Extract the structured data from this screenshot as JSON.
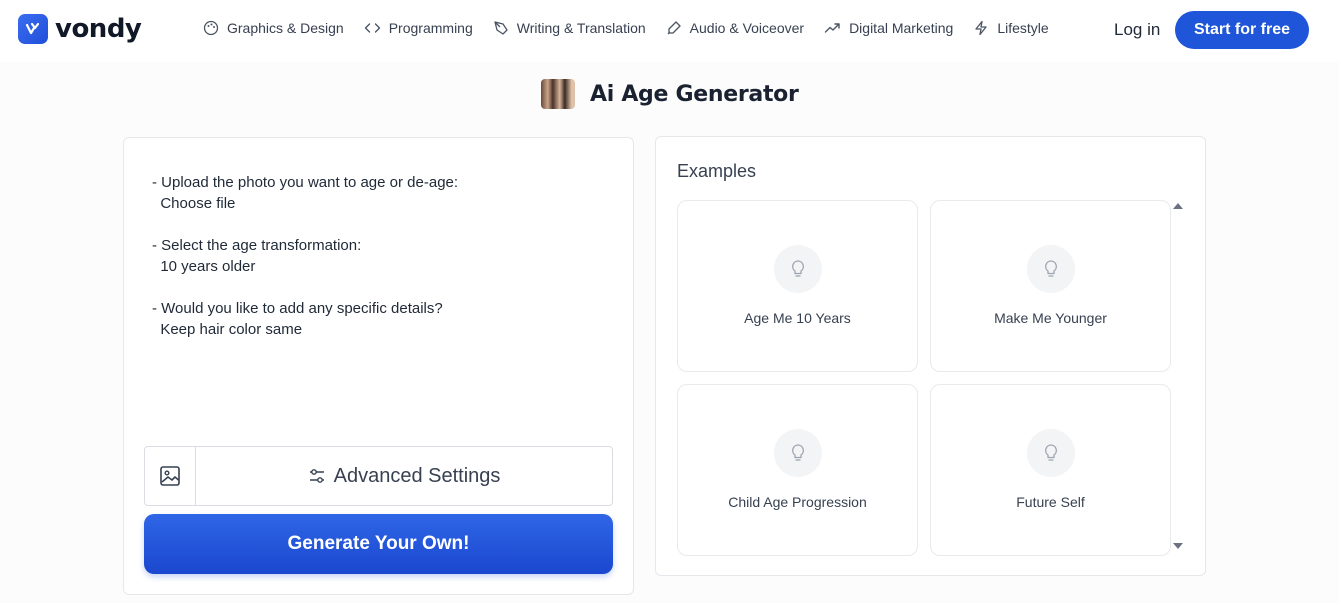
{
  "brand": {
    "name": "vondy",
    "accent": "#1f55d8"
  },
  "nav": {
    "items": [
      {
        "label": "Graphics & Design",
        "icon": "palette-icon"
      },
      {
        "label": "Programming",
        "icon": "code-icon"
      },
      {
        "label": "Writing & Translation",
        "icon": "pen-nib-icon"
      },
      {
        "label": "Audio & Voiceover",
        "icon": "microphone-icon"
      },
      {
        "label": "Digital Marketing",
        "icon": "trend-up-icon"
      },
      {
        "label": "Lifestyle",
        "icon": "lightning-icon"
      }
    ],
    "login": "Log in",
    "start": "Start for free"
  },
  "page": {
    "title": "Ai Age Generator"
  },
  "prompt": {
    "lines": [
      "- Upload the photo you want to age or de-age:",
      "  Choose file",
      "",
      "- Select the age transformation:",
      "  10 years older",
      "",
      "- Would you like to add any specific details?",
      "  Keep hair color same"
    ]
  },
  "toolbar": {
    "advanced_label": "Advanced Settings",
    "image_icon": "image-icon",
    "settings_icon": "sliders-icon"
  },
  "generate_label": "Generate Your Own!",
  "examples": {
    "title": "Examples",
    "cards": [
      {
        "label": "Age Me 10 Years",
        "icon": "lightbulb-icon"
      },
      {
        "label": "Make Me Younger",
        "icon": "lightbulb-icon"
      },
      {
        "label": "Child Age Progression",
        "icon": "lightbulb-icon"
      },
      {
        "label": "Future Self",
        "icon": "lightbulb-icon"
      }
    ]
  }
}
